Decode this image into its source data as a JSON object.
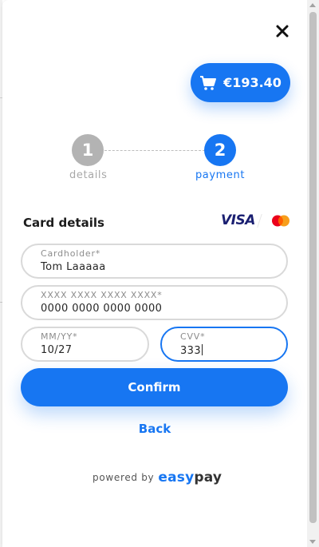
{
  "cart": {
    "amount": "€193.40",
    "icon": "cart-icon"
  },
  "close": {
    "icon": "close-icon"
  },
  "steps": [
    {
      "number": "1",
      "label": "details",
      "state": "completed"
    },
    {
      "number": "2",
      "label": "payment",
      "state": "active"
    }
  ],
  "card_section": {
    "title": "Card details",
    "brands": {
      "visa": "VISA",
      "mastercard_icon": "mastercard-icon"
    }
  },
  "form": {
    "cardholder": {
      "label": "Cardholder*",
      "value": "Tom Laaaaa"
    },
    "number": {
      "label": "XXXX XXXX XXXX XXXX*",
      "value": "0000 0000 0000 0000"
    },
    "expiry": {
      "label": "MM/YY*",
      "value": "10/27"
    },
    "cvv": {
      "label": "CVV*",
      "value": "333",
      "focused": true
    }
  },
  "actions": {
    "confirm_label": "Confirm",
    "back_label": "Back"
  },
  "footer": {
    "powered_by": "powered by",
    "brand_accent": "easy",
    "brand_rest": "pay"
  },
  "colors": {
    "accent": "#1776f2",
    "step_inactive": "#b3b3b3",
    "field_border": "#d9d9d9"
  }
}
